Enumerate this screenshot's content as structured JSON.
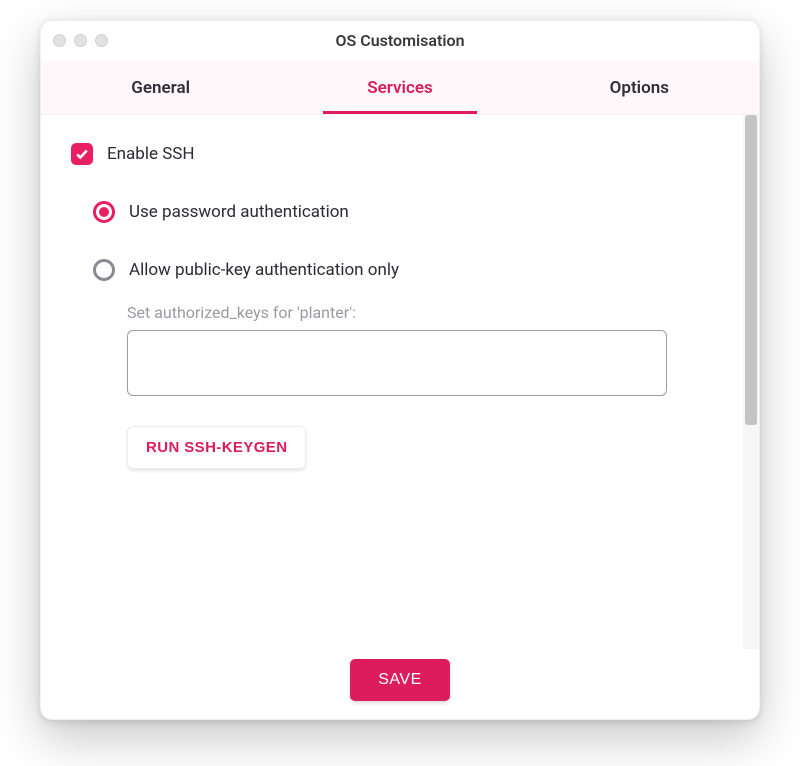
{
  "window": {
    "title": "OS Customisation"
  },
  "tabs": {
    "general": "General",
    "services": "Services",
    "options": "Options",
    "active": "services"
  },
  "services": {
    "enable_ssh": {
      "label": "Enable SSH",
      "checked": true
    },
    "auth_mode": "password",
    "password_auth_label": "Use password authentication",
    "pubkey_auth_label": "Allow public-key authentication only",
    "authorized_keys": {
      "label": "Set authorized_keys for 'planter':",
      "value": ""
    },
    "keygen_button": "RUN SSH-KEYGEN"
  },
  "actions": {
    "save": "SAVE"
  },
  "colors": {
    "accent": "#dc1c5c",
    "checkbox": "#e91e63"
  }
}
